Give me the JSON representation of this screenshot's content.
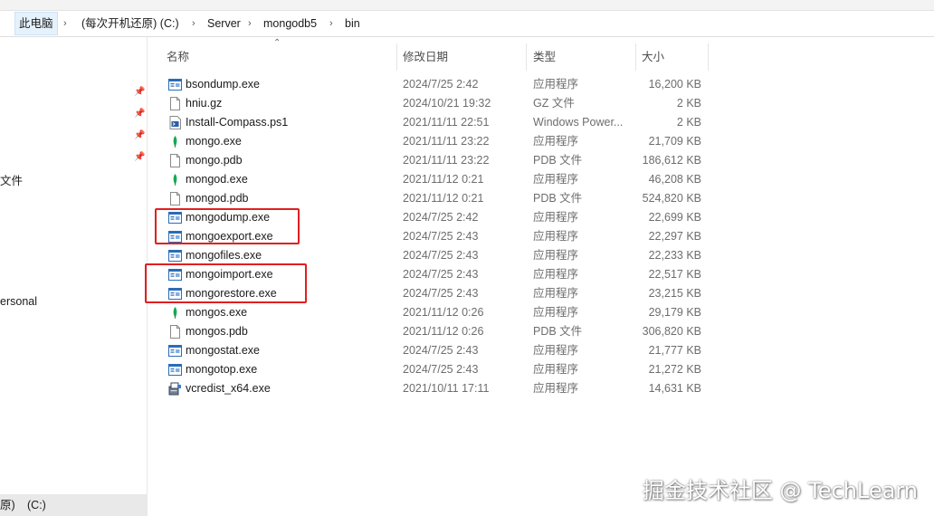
{
  "address_bar": {
    "segments": [
      "此电脑",
      "(每次开机还原) (C:)",
      "Server",
      "mongodb5",
      "bin"
    ]
  },
  "nav_pane": {
    "partial_labels": [
      "文件",
      "ersonal"
    ]
  },
  "status_bar": {
    "path_text": "原)",
    "drive_text": "(C:)"
  },
  "columns": {
    "name": "名称",
    "date": "修改日期",
    "type": "类型",
    "size": "大小"
  },
  "files": [
    {
      "name": "bsondump.exe",
      "date": "2024/7/25 2:42",
      "type": "应用程序",
      "size": "16,200 KB",
      "icon": "exe-window-icon"
    },
    {
      "name": "hniu.gz",
      "date": "2024/10/21 19:32",
      "type": "GZ 文件",
      "size": "2 KB",
      "icon": "file-icon"
    },
    {
      "name": "Install-Compass.ps1",
      "date": "2021/11/11 22:51",
      "type": "Windows Power...",
      "size": "2 KB",
      "icon": "powershell-script-icon"
    },
    {
      "name": "mongo.exe",
      "date": "2021/11/11 23:22",
      "type": "应用程序",
      "size": "21,709 KB",
      "icon": "mongodb-leaf-icon"
    },
    {
      "name": "mongo.pdb",
      "date": "2021/11/11 23:22",
      "type": "PDB 文件",
      "size": "186,612 KB",
      "icon": "file-icon"
    },
    {
      "name": "mongod.exe",
      "date": "2021/11/12 0:21",
      "type": "应用程序",
      "size": "46,208 KB",
      "icon": "mongodb-leaf-icon"
    },
    {
      "name": "mongod.pdb",
      "date": "2021/11/12 0:21",
      "type": "PDB 文件",
      "size": "524,820 KB",
      "icon": "file-icon"
    },
    {
      "name": "mongodump.exe",
      "date": "2024/7/25 2:42",
      "type": "应用程序",
      "size": "22,699 KB",
      "icon": "exe-window-icon"
    },
    {
      "name": "mongoexport.exe",
      "date": "2024/7/25 2:43",
      "type": "应用程序",
      "size": "22,297 KB",
      "icon": "exe-window-icon"
    },
    {
      "name": "mongofiles.exe",
      "date": "2024/7/25 2:43",
      "type": "应用程序",
      "size": "22,233 KB",
      "icon": "exe-window-icon"
    },
    {
      "name": "mongoimport.exe",
      "date": "2024/7/25 2:43",
      "type": "应用程序",
      "size": "22,517 KB",
      "icon": "exe-window-icon"
    },
    {
      "name": "mongorestore.exe",
      "date": "2024/7/25 2:43",
      "type": "应用程序",
      "size": "23,215 KB",
      "icon": "exe-window-icon"
    },
    {
      "name": "mongos.exe",
      "date": "2021/11/12 0:26",
      "type": "应用程序",
      "size": "29,179 KB",
      "icon": "mongodb-leaf-icon"
    },
    {
      "name": "mongos.pdb",
      "date": "2021/11/12 0:26",
      "type": "PDB 文件",
      "size": "306,820 KB",
      "icon": "file-icon"
    },
    {
      "name": "mongostat.exe",
      "date": "2024/7/25 2:43",
      "type": "应用程序",
      "size": "21,777 KB",
      "icon": "exe-window-icon"
    },
    {
      "name": "mongotop.exe",
      "date": "2024/7/25 2:43",
      "type": "应用程序",
      "size": "21,272 KB",
      "icon": "exe-window-icon"
    },
    {
      "name": "vcredist_x64.exe",
      "date": "2021/10/11 17:11",
      "type": "应用程序",
      "size": "14,631 KB",
      "icon": "installer-icon"
    }
  ],
  "highlight_color": "#e02020",
  "watermark": "掘金技术社区 @ TechLearn"
}
